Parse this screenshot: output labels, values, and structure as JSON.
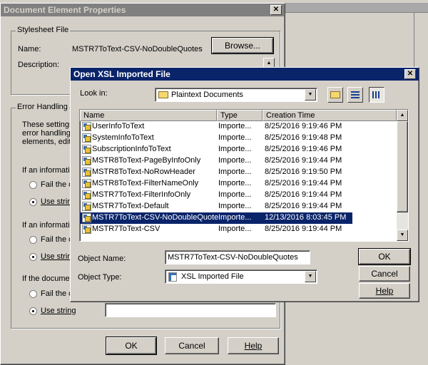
{
  "bg_dialog": {
    "title": "Document Element Properties",
    "close": "✕",
    "stylesheet_group": "Stylesheet File",
    "name_label": "Name:",
    "name_value": "MSTR7ToText-CSV-NoDoubleQuotes",
    "browse_label": "Browse...",
    "description_label": "Description:",
    "error_group": "Error Handling",
    "error_text_1": "These settings",
    "error_text_2": "error handling i",
    "error_text_3": "elements, edit t",
    "if_info_1": "If an informatio",
    "opt_fail_1": "Fail the d",
    "opt_use_1": "Use string",
    "if_info_2": "If an informatio",
    "opt_fail_2": "Fail the d",
    "opt_use_2": "Use string",
    "if_doc": "If the documer",
    "opt_fail_3": "Fail the d",
    "opt_use_3": "Use string",
    "ok_label": "OK",
    "cancel_label": "Cancel",
    "help_label": "Help"
  },
  "dialog": {
    "title": "Open XSL Imported File",
    "close": "✕",
    "look_in_label": "Look in:",
    "look_in_value": "Plaintext Documents",
    "columns": [
      "Name",
      "Type",
      "Creation Time"
    ],
    "files": [
      {
        "name": "UserInfoToText",
        "type": "Importe...",
        "time": "8/25/2016 9:19:46 PM"
      },
      {
        "name": "SystemInfoToText",
        "type": "Importe...",
        "time": "8/25/2016 9:19:48 PM"
      },
      {
        "name": "SubscriptionInfoToText",
        "type": "Importe...",
        "time": "8/25/2016 9:19:46 PM"
      },
      {
        "name": "MSTR8ToText-PageByInfoOnly",
        "type": "Importe...",
        "time": "8/25/2016 9:19:44 PM"
      },
      {
        "name": "MSTR8ToText-NoRowHeader",
        "type": "Importe...",
        "time": "8/25/2016 9:19:50 PM"
      },
      {
        "name": "MSTR8ToText-FilterNameOnly",
        "type": "Importe...",
        "time": "8/25/2016 9:19:44 PM"
      },
      {
        "name": "MSTR7ToText-FilterInfoOnly",
        "type": "Importe...",
        "time": "8/25/2016 9:19:44 PM"
      },
      {
        "name": "MSTR7ToText-Default",
        "type": "Importe...",
        "time": "8/25/2016 9:19:44 PM"
      },
      {
        "name": "MSTR7ToText-CSV-NoDoubleQuotes",
        "type": "Importe...",
        "time": "12/13/2016 8:03:45 PM"
      },
      {
        "name": "MSTR7ToText-CSV",
        "type": "Importe...",
        "time": "8/25/2016 9:19:44 PM"
      }
    ],
    "selected_index": 8,
    "object_name_label": "Object Name:",
    "object_name_value": "MSTR7ToText-CSV-NoDoubleQuotes",
    "object_type_label": "Object Type:",
    "object_type_value": "XSL Imported File",
    "ok_label": "OK",
    "cancel_label": "Cancel",
    "help_label": "Help"
  },
  "colors": {
    "titlebar": "#0a246a",
    "selection": "#0a246a",
    "face": "#d4d0c8"
  }
}
